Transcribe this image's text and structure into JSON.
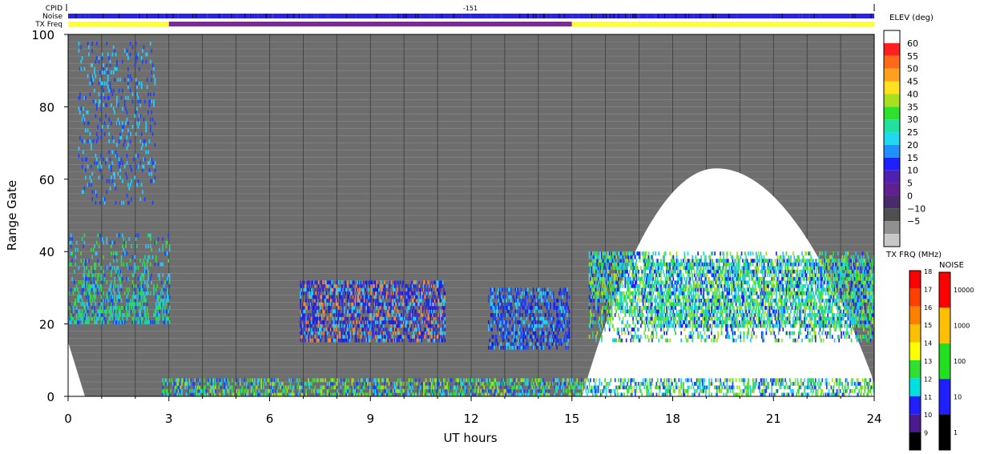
{
  "chart_data": {
    "type": "heatmap",
    "title": "",
    "xlabel": "UT hours",
    "ylabel": "Range Gate",
    "xlim": [
      0,
      24
    ],
    "ylim": [
      0,
      100
    ],
    "x_ticks": [
      "0",
      "3",
      "6",
      "9",
      "12",
      "15",
      "18",
      "21",
      "24"
    ],
    "y_ticks": [
      "0",
      "20",
      "40",
      "60",
      "80",
      "100"
    ],
    "background_color": "#6e6e6e",
    "grid": true,
    "header_rows": {
      "cpid_label": "CPID",
      "cpid_value": "-151",
      "noise_label": "Noise",
      "txfreq_label": "TX Freq",
      "txfreq_segments": [
        {
          "start": 0,
          "end": 3,
          "color": "#ffff33"
        },
        {
          "start": 3,
          "end": 15,
          "color": "#7a2a9a"
        },
        {
          "start": 15,
          "end": 24,
          "color": "#ffff33"
        }
      ]
    },
    "ground_scatter_white_region": {
      "note": "no-data region",
      "peak_time": 19.3,
      "peak_gate": 63,
      "start_time": 15.3,
      "end_time": 24
    },
    "lower_left_white_wedge": {
      "start_gate": 15,
      "end_time": 0.5
    },
    "elev_colorbar": {
      "title": "ELEV (deg)",
      "labels": [
        "60",
        "55",
        "50",
        "45",
        "40",
        "35",
        "30",
        "25",
        "20",
        "15",
        "10",
        "5",
        "0",
        "−10",
        "−5"
      ],
      "colors": [
        "#ffffff",
        "#ff2020",
        "#ff6a1a",
        "#ffa020",
        "#ffe020",
        "#a8e020",
        "#30e030",
        "#20e0a0",
        "#20d8f0",
        "#2090ff",
        "#2020ff",
        "#5020b0",
        "#602090",
        "#4a2a6a",
        "#505050",
        "#909090",
        "#c8c8c8"
      ]
    },
    "txfrq_colorbar": {
      "title": "TX FRQ (MHz)",
      "labels": [
        "18",
        "17",
        "16",
        "15",
        "14",
        "13",
        "12",
        "11",
        "10",
        "9"
      ],
      "colors": [
        "#ff0000",
        "#ff4000",
        "#ff8000",
        "#ffc000",
        "#ffff00",
        "#30e030",
        "#00e0e0",
        "#2020ff",
        "#4a1a90",
        "#000000"
      ]
    },
    "noise_colorbar": {
      "title": "NOISE",
      "labels": [
        "10000",
        "1000",
        "100",
        "10",
        "1"
      ],
      "colors": [
        "#ff0000",
        "#ffc000",
        "#20e020",
        "#2020ff",
        "#000000"
      ]
    },
    "scatter_regions": [
      {
        "name": "early-echo-band",
        "t0": 0,
        "t1": 3,
        "g0": 20,
        "g1": 45,
        "palette": [
          "#2040ff",
          "#30c0ff",
          "#30e030",
          "#20d0a0"
        ]
      },
      {
        "name": "high-range-blobs",
        "t0": 0.3,
        "t1": 2.6,
        "g0": 53,
        "g1": 98,
        "palette": [
          "#2040ff",
          "#20d0ff"
        ]
      },
      {
        "name": "midday-band",
        "t0": 6.9,
        "t1": 11.2,
        "g0": 15,
        "g1": 32,
        "palette": [
          "#1820d0",
          "#2a2ae0",
          "#4a30c0",
          "#ff8a20",
          "#20d0ff"
        ]
      },
      {
        "name": "afternoon-band",
        "t0": 12.5,
        "t1": 14.9,
        "g0": 13,
        "g1": 30,
        "palette": [
          "#1820d0",
          "#2040ff",
          "#20d0ff"
        ]
      },
      {
        "name": "late-band",
        "t0": 15.5,
        "t1": 24,
        "g0": 15,
        "g1": 40,
        "palette": [
          "#2020ff",
          "#20c0ff",
          "#20e0c0",
          "#30e030",
          "#a0e020"
        ]
      },
      {
        "name": "near-range-strip",
        "t0": 2.8,
        "t1": 24,
        "g0": 0,
        "g1": 5,
        "palette": [
          "#30e030",
          "#20d0ff",
          "#2040ff",
          "#a0e020"
        ]
      }
    ]
  }
}
